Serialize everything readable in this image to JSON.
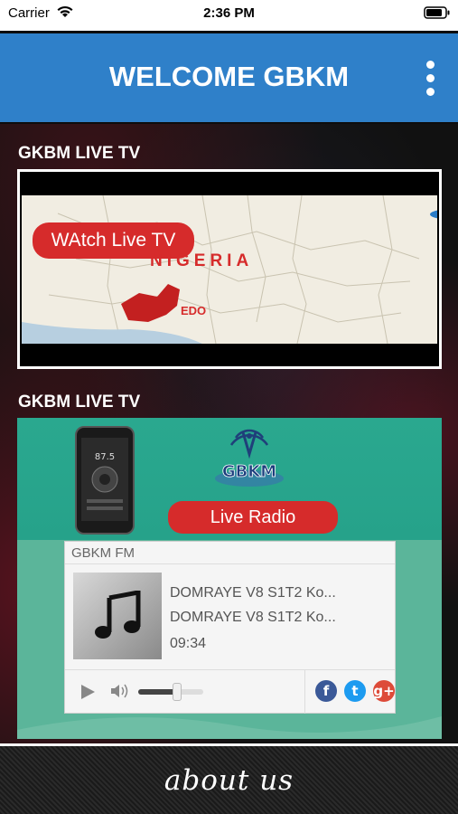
{
  "status_bar": {
    "carrier": "Carrier",
    "time": "2:36 PM",
    "icons": [
      "wifi-icon",
      "battery-icon"
    ]
  },
  "header": {
    "title": "WELCOME GBKM",
    "menu_icon": "more-vertical-icon",
    "color": "#2f80c9"
  },
  "tv_section": {
    "label": "GKBM LIVE TV",
    "watch_button": "WAtch Live TV",
    "map_country": "NIGERIA",
    "map_state": "EDO"
  },
  "radio_section": {
    "label": "GKBM LIVE TV",
    "logo_text": "GBKM",
    "phone_frequency": "87.5",
    "live_radio_button": "Live Radio",
    "player": {
      "station": "GBKM FM",
      "track_title": "DOMRAYE V8 S1T2 Ko...",
      "track_artist": "DOMRAYE V8 S1T2 Ko...",
      "time": "09:34",
      "volume_level": 0.6,
      "social": [
        {
          "icon": "facebook-icon",
          "glyph": "f",
          "color": "#3b5998"
        },
        {
          "icon": "twitter-icon",
          "glyph": "t",
          "color": "#1d9bf0"
        },
        {
          "icon": "google-plus-icon",
          "glyph": "g+",
          "color": "#dd4b39"
        }
      ]
    }
  },
  "footer": {
    "about_label": "about us"
  },
  "colors": {
    "accent_red": "#d62b2b",
    "radio_green": "#2aa88f"
  }
}
